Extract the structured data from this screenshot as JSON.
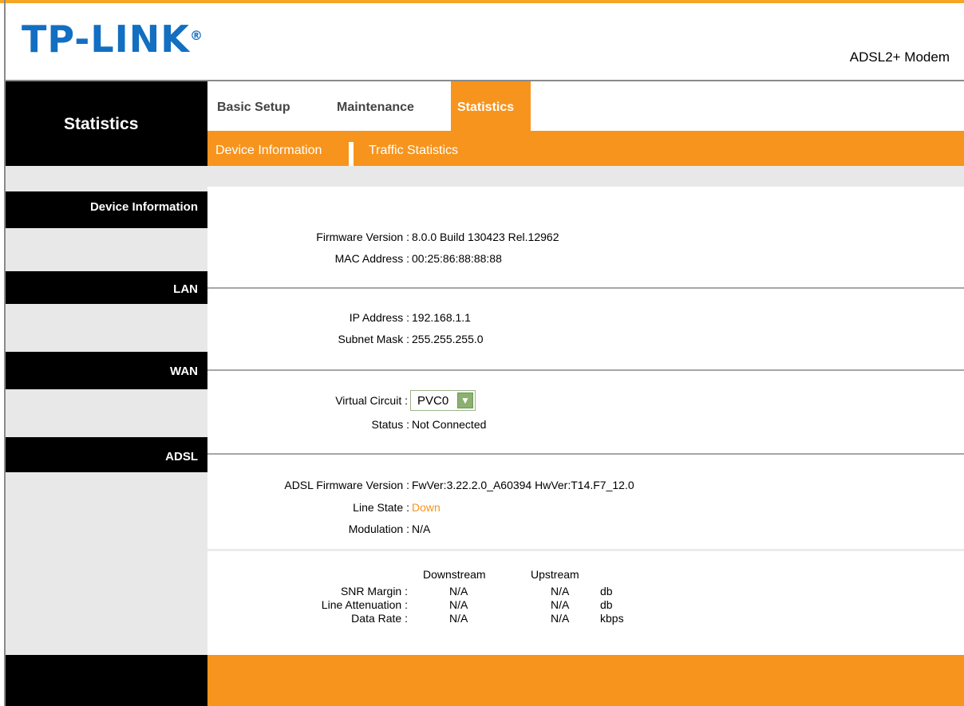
{
  "header": {
    "logo": "TP-LINK",
    "logo_mark": "®",
    "product": "ADSL2+ Modem"
  },
  "left_title": "Statistics",
  "tabs": [
    {
      "label": "Basic Setup"
    },
    {
      "label": "Maintenance"
    },
    {
      "label": "Statistics",
      "active": true
    }
  ],
  "subtabs": [
    {
      "label": "Device Information",
      "active": true
    },
    {
      "label": "Traffic Statistics"
    }
  ],
  "sections": {
    "device": {
      "title": "Device Information",
      "firmware_label": "Firmware Version :",
      "firmware_value": "8.0.0 Build 130423 Rel.12962",
      "mac_label": "MAC Address :",
      "mac_value": "00:25:86:88:88:88"
    },
    "lan": {
      "title": "LAN",
      "ip_label": "IP Address :",
      "ip_value": "192.168.1.1",
      "mask_label": "Subnet Mask :",
      "mask_value": "255.255.255.0"
    },
    "wan": {
      "title": "WAN",
      "vc_label": "Virtual Circuit :",
      "vc_value": "PVC0",
      "status_label": "Status :",
      "status_value": "Not Connected"
    },
    "adsl": {
      "title": "ADSL",
      "fw_label": "ADSL Firmware Version :",
      "fw_value": "FwVer:3.22.2.0_A60394 HwVer:T14.F7_12.0",
      "line_state_label": "Line State :",
      "line_state_value": "Down",
      "modulation_label": "Modulation :",
      "modulation_value": "N/A",
      "stats": {
        "col_down": "Downstream",
        "col_up": "Upstream",
        "rows": [
          {
            "label": "SNR Margin :",
            "down": "N/A",
            "up": "N/A",
            "unit": "db"
          },
          {
            "label": "Line Attenuation :",
            "down": "N/A",
            "up": "N/A",
            "unit": "db"
          },
          {
            "label": "Data Rate :",
            "down": "N/A",
            "up": "N/A",
            "unit": "kbps"
          }
        ]
      }
    }
  },
  "colors": {
    "accent": "#f7941d",
    "brand": "#126fc1",
    "sidebar": "#000000"
  },
  "icons": {
    "select_arrow": "chevron-down-icon"
  }
}
